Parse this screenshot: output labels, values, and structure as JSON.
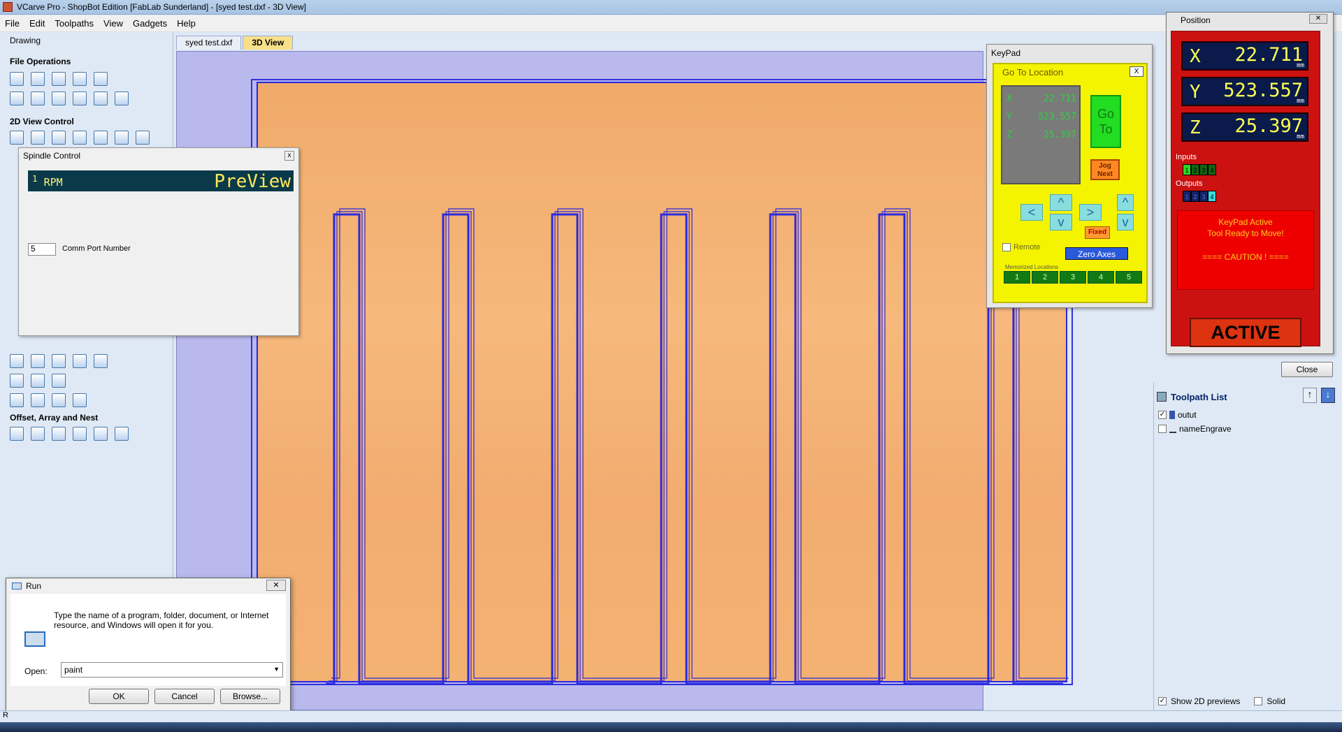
{
  "window": {
    "title": "VCarve Pro - ShopBot Edition [FabLab Sunderland] - [syed test.dxf - 3D View]"
  },
  "menu": [
    "File",
    "Edit",
    "Toolpaths",
    "View",
    "Gadgets",
    "Help"
  ],
  "left_panel": {
    "title": "Drawing",
    "sections": {
      "file_ops": "File Operations",
      "view_control": "2D View Control",
      "offset": "Offset, Array and Nest"
    }
  },
  "tabs": [
    "syed test.dxf",
    "3D View"
  ],
  "spindle": {
    "title": "Spindle Control",
    "rpm_label": "RPM",
    "rpm_marker": "1",
    "display": "PreView",
    "port_value": "5",
    "port_label": "Comm Port Number"
  },
  "keypad": {
    "title": "KeyPad",
    "goto_title": "Go To Location",
    "close": "X",
    "lcd": {
      "x_label": "X",
      "x": "22.711",
      "y_label": "Y",
      "y": "523.557",
      "z_label": "Z",
      "z": "25.397"
    },
    "goto_btn": "Go To",
    "jog_next": "Jog Next",
    "left": "<",
    "up": "^",
    "right": ">",
    "down": "v",
    "z_up": "^",
    "z_down": "v",
    "fixed": "Fixed",
    "remote": "Remote",
    "zero_axes": "Zero Axes",
    "memorized_label": "Memorized Locations",
    "memorized": [
      "1",
      "2",
      "3",
      "4",
      "5"
    ]
  },
  "position": {
    "title": "Position",
    "close": "✕",
    "axes": [
      {
        "name": "X",
        "value": "22.711",
        "unit": "mm"
      },
      {
        "name": "Y",
        "value": "523.557",
        "unit": "mm"
      },
      {
        "name": "Z",
        "value": "25.397",
        "unit": "mm"
      }
    ],
    "inputs_label": "Inputs",
    "inputs": [
      "1",
      "2",
      "3",
      "4"
    ],
    "outputs_label": "Outputs",
    "outputs": [
      "1",
      "2",
      "3",
      "4"
    ],
    "status_line1": "KeyPad Active",
    "status_line2": "Tool Ready to Move!",
    "caution": "==== CAUTION ! ====",
    "active_btn": "ACTIVE",
    "close_btn": "Close"
  },
  "toolpath_list": {
    "title": "Toolpath List",
    "items": [
      {
        "label": "outut",
        "checked": true
      },
      {
        "label": "nameEngrave",
        "checked": false
      }
    ],
    "show_2d": "Show 2D previews",
    "solid": "Solid"
  },
  "run": {
    "title": "Run",
    "close": "✕",
    "description": "Type the name of a program, folder, document, or Internet resource, and Windows will open it for you.",
    "open_label": "Open:",
    "open_value": "paint",
    "ok": "OK",
    "cancel": "Cancel",
    "browse": "Browse..."
  },
  "status": {
    "text": "R"
  },
  "colors": {
    "board": "#f4b272",
    "toolpath": "#2a2ae0",
    "view_bg": "#b9b9ee",
    "keypad": "#f4f400",
    "position": "#cc1111"
  }
}
